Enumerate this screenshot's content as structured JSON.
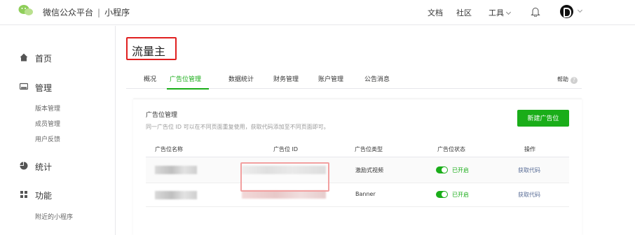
{
  "header": {
    "brand": "微信公众平台",
    "separator": "|",
    "product": "小程序",
    "links": {
      "docs": "文档",
      "community": "社区",
      "tools": "工具"
    }
  },
  "sidebar": {
    "home": "首页",
    "manage": "管理",
    "manage_items": [
      "版本管理",
      "成员管理",
      "用户反馈"
    ],
    "stats": "统计",
    "features": "功能",
    "features_items": [
      "附近的小程序"
    ]
  },
  "page": {
    "title": "流量主"
  },
  "tabs": [
    "概况",
    "广告位管理",
    "数据统计",
    "财务管理",
    "账户管理",
    "公告消息"
  ],
  "active_tab": "广告位管理",
  "help": {
    "label": "帮助",
    "icon_glyph": "?"
  },
  "section": {
    "title": "广告位管理",
    "description": "同一广告位 ID 可以在不同页面重复使用，获取代码添加至不同页面即可。",
    "new_button": "新建广告位"
  },
  "table": {
    "headers": [
      "广告位名称",
      "广告位 ID",
      "广告位类型",
      "广告位状态",
      "操作"
    ],
    "rows": [
      {
        "type": "激励式视频",
        "status": "已开启",
        "action": "获取代码"
      },
      {
        "type": "Banner",
        "status": "已开启",
        "action": "获取代码"
      }
    ]
  },
  "colors": {
    "accent": "#1aad19",
    "link": "#576b95",
    "highlight_border": "#e02020"
  }
}
